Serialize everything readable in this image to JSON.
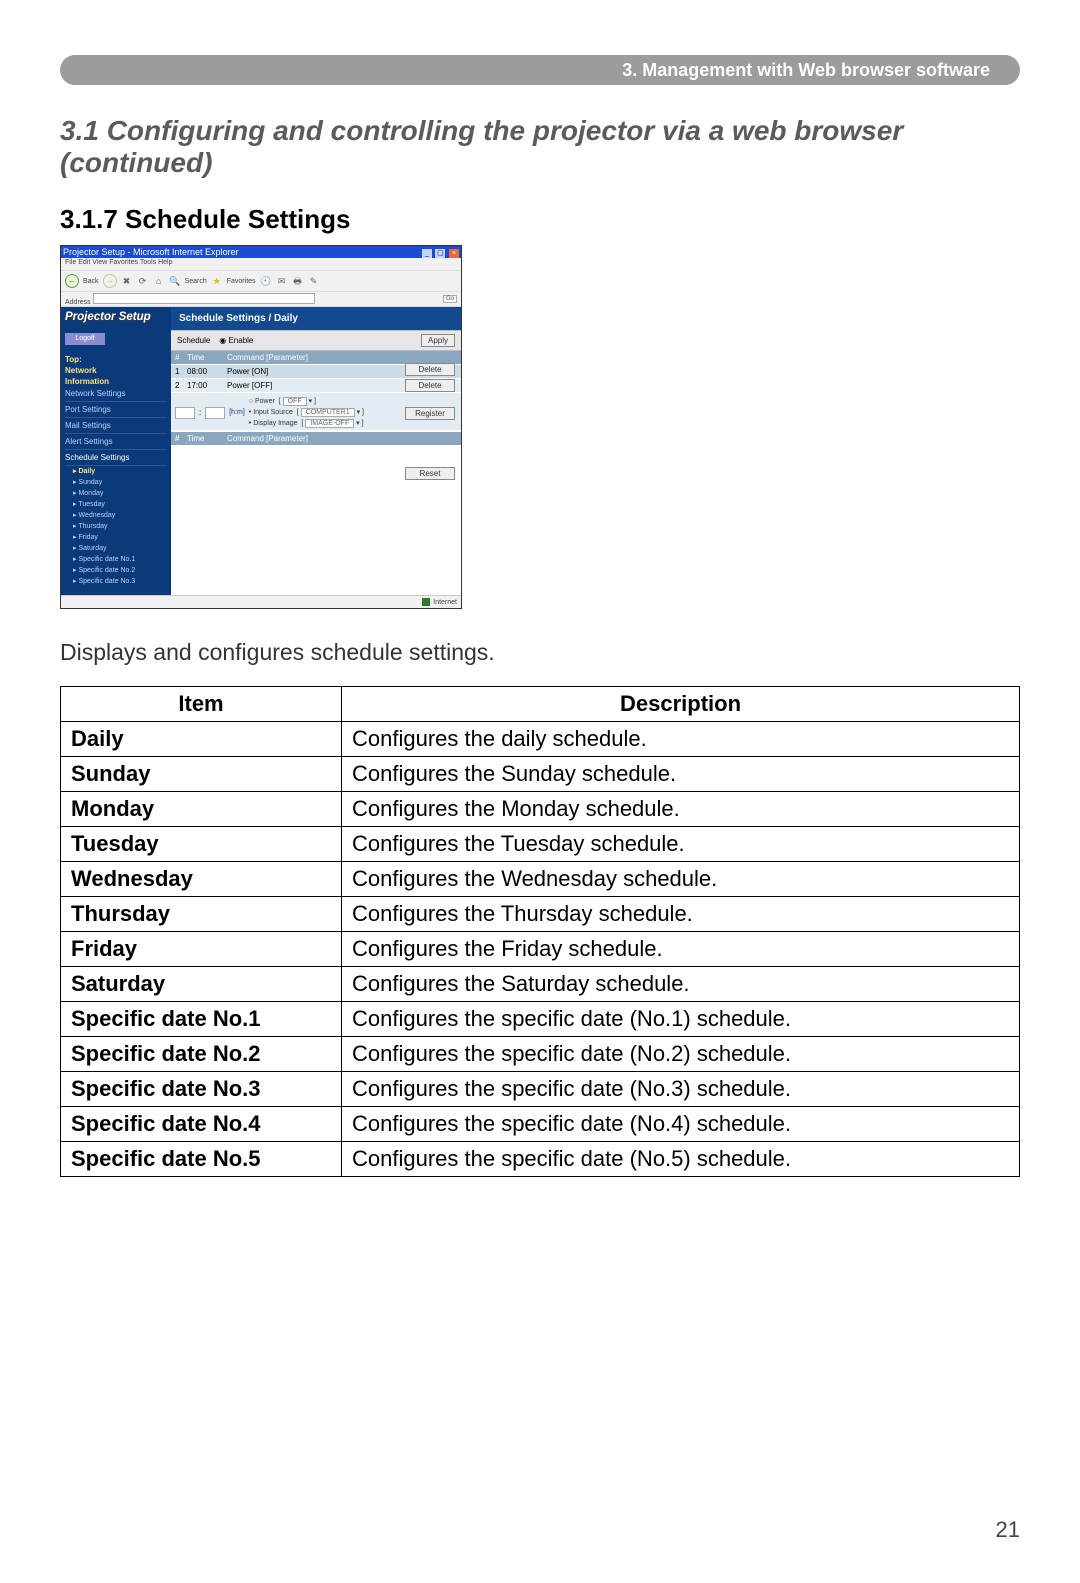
{
  "breadcrumb": "3. Management with Web browser software",
  "section_title": "3.1 Configuring and controlling the projector via a web browser (continued)",
  "subsection_title": "3.1.7 Schedule Settings",
  "intro_text": "Displays and configures schedule settings.",
  "page_number": "21",
  "table": {
    "headers": [
      "Item",
      "Description"
    ],
    "rows": [
      {
        "item": "Daily",
        "desc": "Configures the daily schedule."
      },
      {
        "item": "Sunday",
        "desc": "Configures the Sunday schedule."
      },
      {
        "item": "Monday",
        "desc": "Configures the Monday schedule."
      },
      {
        "item": "Tuesday",
        "desc": "Configures the Tuesday schedule."
      },
      {
        "item": "Wednesday",
        "desc": "Configures the Wednesday schedule."
      },
      {
        "item": "Thursday",
        "desc": "Configures the Thursday schedule."
      },
      {
        "item": "Friday",
        "desc": "Configures the Friday schedule."
      },
      {
        "item": "Saturday",
        "desc": "Configures the Saturday schedule."
      },
      {
        "item": "Specific date No.1",
        "desc": "Configures the specific date (No.1) schedule."
      },
      {
        "item": "Specific date No.2",
        "desc": "Configures the specific date (No.2) schedule."
      },
      {
        "item": "Specific date No.3",
        "desc": "Configures the specific date (No.3) schedule."
      },
      {
        "item": "Specific date No.4",
        "desc": "Configures the specific date (No.4) schedule."
      },
      {
        "item": "Specific date No.5",
        "desc": "Configures the specific date (No.5) schedule."
      }
    ]
  },
  "shot": {
    "window_title": "Projector Setup - Microsoft Internet Explorer",
    "menubar": "File  Edit  View  Favorites  Tools  Help",
    "toolbar": {
      "back": "Back",
      "search": "Search",
      "favorites": "Favorites"
    },
    "address_label": "Address",
    "go": "Go",
    "statusbar": "Internet",
    "sidebar": {
      "title": "Projector Setup",
      "logoff": "Logoff",
      "heads": {
        "top": "Top:",
        "network": "Network",
        "information": "Information"
      },
      "items": {
        "network_settings": "Network Settings",
        "port_settings": "Port Settings",
        "mail_settings": "Mail Settings",
        "alert_settings": "Alert Settings",
        "schedule_settings": "Schedule Settings"
      },
      "sub": {
        "daily": "▸ Daily",
        "sunday": "▸ Sunday",
        "monday": "▸ Monday",
        "tuesday": "▸ Tuesday",
        "wednesday": "▸ Wednesday",
        "thursday": "▸ Thursday",
        "friday": "▸ Friday",
        "saturday": "▸ Saturday",
        "sd1": "▸ Specific date No.1",
        "sd2": "▸ Specific date No.2",
        "sd3": "▸ Specific date No.3"
      }
    },
    "main": {
      "title": "Schedule Settings / Daily",
      "schedule_label": "Schedule",
      "enable_label": "Enable",
      "apply": "Apply",
      "th_num": "#",
      "th_time": "Time",
      "th_cmd": "Command [Parameter]",
      "rows": [
        {
          "n": "1",
          "time": "08:00",
          "cmd": "Power [ON]"
        },
        {
          "n": "2",
          "time": "17:00",
          "cmd": "Power [OFF]"
        }
      ],
      "delete": "Delete",
      "register": "Register",
      "reset": "Reset",
      "edit": {
        "hm_label": "[h:m]",
        "power_label": "Power",
        "power_sel": "OFF",
        "input_label": "• Input Source",
        "input_sel": "COMPUTER1",
        "image_label": "• Display Image",
        "image_sel": "IMAGE-OFF"
      }
    }
  }
}
